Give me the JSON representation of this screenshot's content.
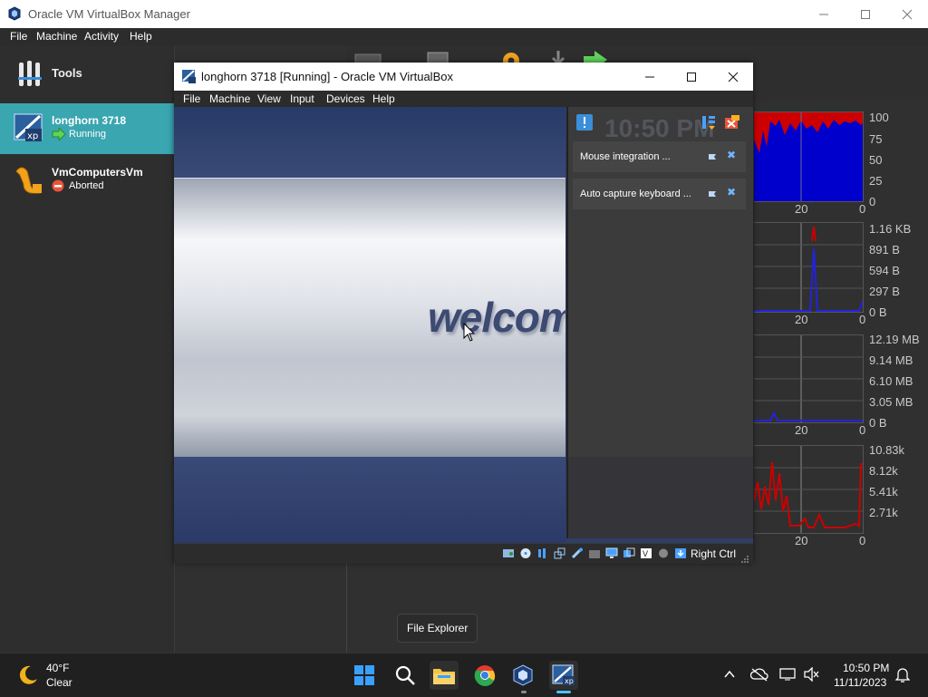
{
  "manager": {
    "title": "Oracle VM VirtualBox Manager",
    "menu": [
      "File",
      "Machine",
      "Activity",
      "Help"
    ],
    "tools_label": "Tools",
    "vms": [
      {
        "name": "longhorn 3718",
        "state": "Running",
        "selected": true
      },
      {
        "name": "VmComputersVm",
        "state": "Aborted",
        "selected": false
      }
    ],
    "perf": {
      "cpu_ticks": [
        "100",
        "75",
        "50",
        "25",
        "0"
      ],
      "ram_ticks": [
        "1.16 KB",
        "891 B",
        "594 B",
        "297 B",
        "0 B"
      ],
      "disk_ticks": [
        "12.19 MB",
        "9.14 MB",
        "6.10 MB",
        "3.05 MB",
        "0 B"
      ],
      "net_ticks": [
        "10.83k",
        "8.12k",
        "5.41k",
        "2.71k"
      ],
      "x_ticks": [
        "20",
        "0"
      ]
    }
  },
  "vm_window": {
    "title": "longhorn 3718 [Running] - Oracle VM VirtualBox",
    "menu": [
      "File",
      "Machine",
      "View",
      "Input",
      "Devices",
      "Help"
    ],
    "screen_text": "welcome",
    "clock_ghost": "10:50 PM",
    "notifications": [
      {
        "text": "Mouse integration ..."
      },
      {
        "text": "Auto capture keyboard ..."
      }
    ],
    "host_key": "Right Ctrl"
  },
  "tooltip": "File Explorer",
  "taskbar": {
    "weather_temp": "40°F",
    "weather_desc": "Clear",
    "time": "10:50 PM",
    "date": "11/11/2023"
  },
  "colors": {
    "selection": "#3aa6b0",
    "graph_fill": "#0000cc",
    "graph_red": "#cc0000",
    "accent_blue": "#4cc2ff"
  }
}
